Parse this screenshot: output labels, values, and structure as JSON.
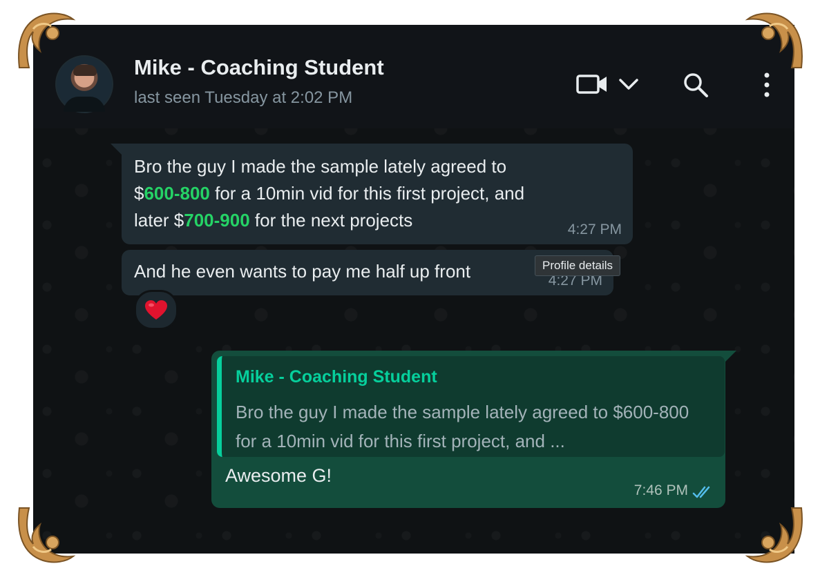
{
  "header": {
    "contact_name": "Mike - Coaching Student",
    "last_seen": "last seen Tuesday at 2:02 PM",
    "icons": [
      "video-call-icon",
      "chevron-down-icon",
      "search-icon",
      "more-options-icon"
    ]
  },
  "messages": [
    {
      "direction": "incoming",
      "parts": [
        {
          "text": "Bro the guy I made the sample lately agreed to\n$",
          "highlight": false
        },
        {
          "text": "600-800",
          "highlight": true
        },
        {
          "text": " for a 10min vid for this first project, and\nlater $",
          "highlight": false
        },
        {
          "text": "700-900",
          "highlight": true
        },
        {
          "text": " for the next projects",
          "highlight": false
        }
      ],
      "time": "4:27 PM"
    },
    {
      "direction": "incoming",
      "text": "And he even wants to pay me half up front",
      "time": "4:27 PM",
      "reaction": "❤️"
    },
    {
      "direction": "outgoing",
      "quote": {
        "author": "Mike - Coaching Student",
        "text": "Bro the guy I made the sample lately agreed to $600-800 for a 10min vid for this first project, and ..."
      },
      "text": "Awesome G!",
      "time": "7:46 PM",
      "status": "read"
    }
  ],
  "tooltip": "Profile details",
  "colors": {
    "accent_green": "#25d366",
    "quote_green": "#06cf9c",
    "read_tick_blue": "#53bdeb"
  }
}
